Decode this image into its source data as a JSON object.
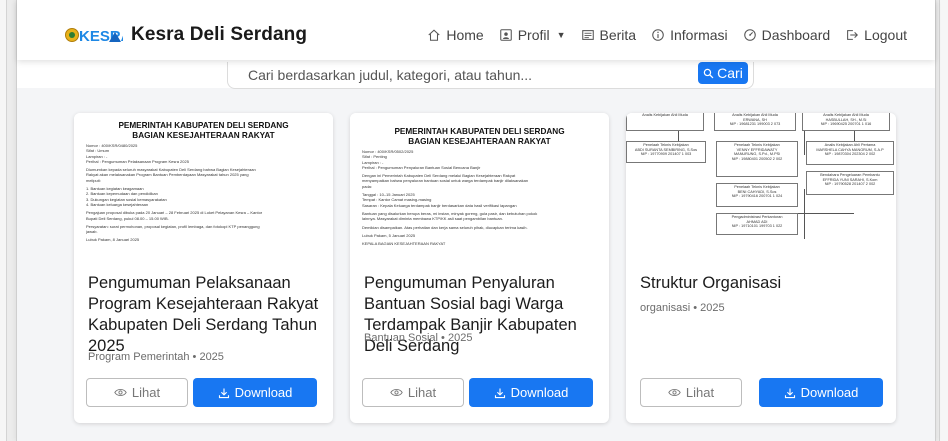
{
  "app": {
    "brand": "Kesra Deli Serdang",
    "logo_text": "KESRA",
    "accent_color": "#1877f2",
    "logo_colors": [
      "#e8b21a",
      "#2e7d32",
      "#1e88e5"
    ]
  },
  "nav": {
    "items": [
      {
        "label": "Home",
        "icon": "home-icon"
      },
      {
        "label": "Profil",
        "icon": "id-card-icon",
        "dropdown": true
      },
      {
        "label": "Berita",
        "icon": "newspaper-icon"
      },
      {
        "label": "Informasi",
        "icon": "info-icon"
      },
      {
        "label": "Dashboard",
        "icon": "speedometer-icon"
      },
      {
        "label": "Logout",
        "icon": "logout-icon"
      }
    ]
  },
  "search": {
    "placeholder": "Cari berdasarkan judul, kategori, atau tahun...",
    "button_label": "Cari",
    "value": ""
  },
  "buttons": {
    "view_label": "Lihat",
    "download_label": "Download"
  },
  "cards": [
    {
      "title": "Pengumuman Pelaksanaan Program Kesejahteraan Rakyat Kabupaten Deli Serdang Tahun 2025",
      "meta": "Program Pemerintah • 2025",
      "preview": {
        "heading_1": "PEMERINTAH KABUPATEN DELI SERDANG",
        "heading_2": "BAGIAN KESEJAHTERAAN RAKYAT",
        "lines": [
          "Nomor : 400/KSR/0480/2025",
          "Sifat : Umum",
          "Lampiran : -",
          "Perihal : Pengumuman Pelaksanaan Program Kesra 2025",
          "",
          "Diumumkan kepada seluruh masyarakat Kabupaten Deli Serdang bahwa Bagian Kesejahteraan",
          "Rakyat akan melaksanakan Program Bantuan Pemberdayaan Masyarakat tahun 2025 yang",
          "meliputi:",
          "",
          "1. Bantuan kegiatan keagamaan",
          "2. Bantuan kepemudaan dan pendidikan",
          "3. Dukungan kegiatan sosial kemasyarakatan",
          "4. Bantuan keluarga kesejahteraan",
          "",
          "Pengajuan proposal dibuka pada 20 Januari – 28 Februari 2025 di Loket Pelayanan Kesra – Kantor",
          "Bupati Deli Serdang, pukul 08.00 – 15.00 WIB.",
          "",
          "Persyaratan: surat permohonan, proposal kegiatan, profil lembaga, dan fotokopi KTP penanggung",
          "jawab.",
          "",
          "Lubuk Pakam, 8 Januari 2025"
        ]
      }
    },
    {
      "title": "Pengumuman Penyaluran Bantuan Sosial bagi Warga Terdampak Banjir Kabupaten Deli Serdang",
      "meta": "Bantuan Sosial • 2025",
      "preview": {
        "heading_1": "PEMERINTAH KABUPATEN DELI SERDANG",
        "heading_2": "BAGIAN KESEJAHTERAAN RAKYAT",
        "lines": [
          "Nomor : 400/KSR/0502/2025",
          "Sifat : Penting",
          "Lampiran : -",
          "Perihal : Pengumuman Penyaluran Bantuan Sosial Bencana Banjir",
          "",
          "Dengan ini Pemerintah Kabupaten Deli Serdang melalui Bagian Kesejahteraan Rakyat",
          "menyampaikan bahwa penyaluran bantuan sosial untuk warga terdampak banjir dilaksanakan",
          "pada:",
          "",
          "Tanggal : 10–15 Januari 2025",
          "Tempat : Kantor Camat masing-masing",
          "Sasaran : Kepala Keluarga terdampak banjir berdasarkan data hasil verifikasi lapangan",
          "",
          "Bantuan yang disalurkan berupa beras, mi instan, minyak goreng, gula pasir, dan kebutuhan pokok",
          "lainnya. Masyarakat diminta membawa KTP/KK asli saat pengambilan bantuan.",
          "",
          "Demikian disampaikan. Atas perhatian dan kerja sama seluruh pihak, diucapkan terima kasih.",
          "",
          "Lubuk Pakam, 5 Januari 2025",
          "",
          "KEPALA BAGIAN KESEJAHTERAAN RAKYAT"
        ]
      }
    },
    {
      "title": "Struktur Organisasi",
      "meta": "organisasi • 2025",
      "preview": {
        "top_row": [
          "Analis Kebijakan Ahli Muda",
          "Analis Kebijakan Ahli Muda\nERWANA, SH\nNIP : 19681231 199003 2 073",
          "Analis Kebijakan Ahli Muda\nHASBULLAH, SH., M.Si\nNIP : 19690425 200701 1 016"
        ],
        "middle_row": [
          "Penelaah Teknis Kebijakan\nABDI SURANTA SEMBIRING, S.Sos\nNIP : 19770909 201407 1 003",
          "Penelaah Teknis Kebijakan\nVENNY EFFRIDAWATY\nMANURUNG, S.Pd., M.PSi\nNIP : 19880401 200502 2 002",
          "Analis Kebijakan Ahli Pertama\nMARSHELA CAHYA MANGRUM, S.A.P\nNIP : 19870304 202304 2 002"
        ],
        "lower_row": [
          "Penelaah Teknis Kebijakan\nBENI CAHYADI, S.Sos\nNIP : 19790416 200701 1 024",
          "Bendahara Pengeluaran Pembantu\nEFFRIDA YUNI SARAHI, S.Kom\nNIP : 19790528 201407 2 002"
        ],
        "bottom_row": [
          "Pengadministrasi Perkantoran\nAHMAD ADI\nNIP : 19710101 199703 1 022"
        ]
      }
    }
  ]
}
